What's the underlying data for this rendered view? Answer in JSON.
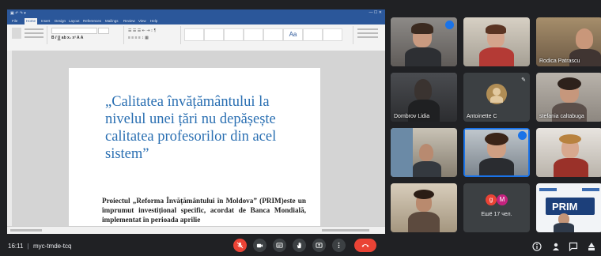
{
  "meeting": {
    "time": "16:11",
    "code": "myc-tmde-tcq"
  },
  "word": {
    "title": "",
    "tabs": [
      "File",
      "Home",
      "Insert",
      "Design",
      "Layout",
      "References",
      "Mailings",
      "Review",
      "View",
      "Help"
    ],
    "quote": "„Calitatea învățământului la nivelul unei țări nu depășește calitatea profesorilor din acel sistem”",
    "paragraph": "Proiectul „Reforma Învățământului în Moldova” (PRIM)este un împrumut investițional specific, acordat de Banca Mondială, implementat în perioada aprilie"
  },
  "participants": [
    {
      "name": "",
      "state": "speaking"
    },
    {
      "name": "",
      "state": "none"
    },
    {
      "name": "Rodica Patrascu",
      "state": "none"
    },
    {
      "name": "Dombrov Lidia",
      "state": "none"
    },
    {
      "name": "Antoinette C",
      "state": "muted"
    },
    {
      "name": "stefania caltabuga",
      "state": "none"
    },
    {
      "name": "",
      "state": "none"
    },
    {
      "name": "",
      "state": "speaking"
    },
    {
      "name": "",
      "state": "none"
    },
    {
      "name": "",
      "state": "none"
    },
    {
      "name": "",
      "state": "none"
    },
    {
      "name": "",
      "state": "none"
    }
  ],
  "others": {
    "label": "Ешё 17 чел.",
    "avatars": [
      "g",
      "M"
    ],
    "colors": [
      "#ea4335",
      "#c5227e"
    ]
  },
  "colors": {
    "accent": "#1a73e8",
    "hangup": "#ea4335",
    "word_blue": "#2b579a",
    "quote_blue": "#2a6fb2"
  },
  "controls": [
    "microphone-off",
    "camera",
    "captions",
    "raise-hand",
    "present",
    "more-options",
    "leave-call"
  ],
  "right_controls": [
    "info",
    "people",
    "chat",
    "activities"
  ]
}
